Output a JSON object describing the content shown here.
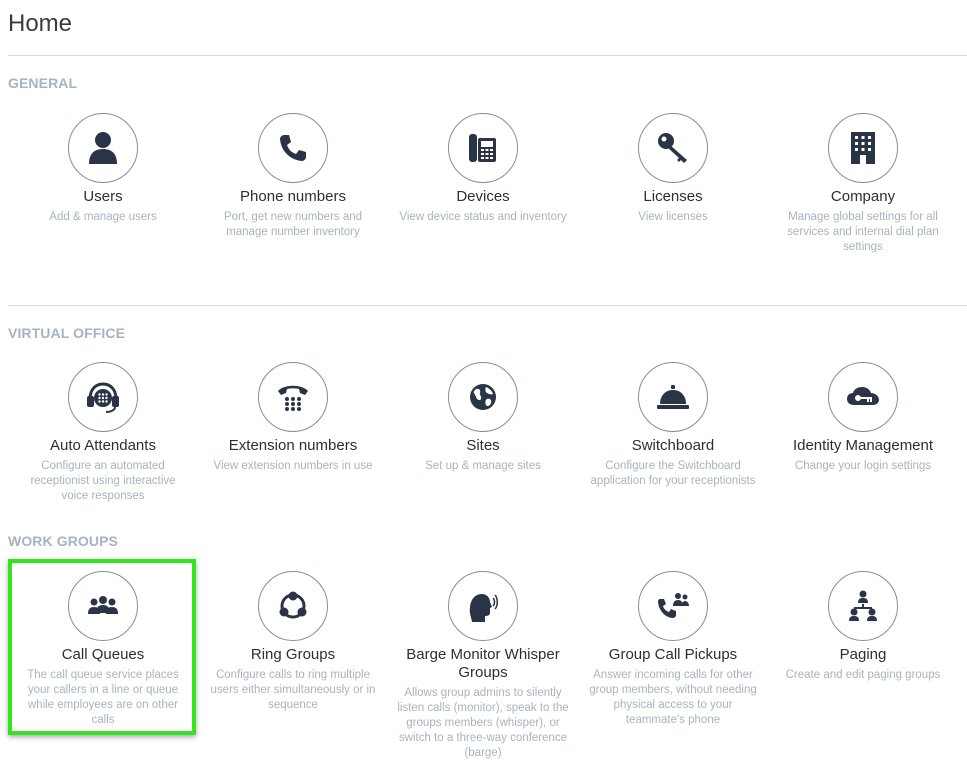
{
  "header": {
    "title": "Home"
  },
  "sections": {
    "general": {
      "title": "GENERAL",
      "tiles": [
        {
          "label": "Users",
          "desc": "Add & manage users",
          "icon": "user-icon"
        },
        {
          "label": "Phone numbers",
          "desc": "Port, get new numbers and manage number inventory",
          "icon": "phone-icon"
        },
        {
          "label": "Devices",
          "desc": "View device status and inventory",
          "icon": "desk-phone-icon"
        },
        {
          "label": "Licenses",
          "desc": "View licenses",
          "icon": "key-icon"
        },
        {
          "label": "Company",
          "desc": "Manage global settings for all services and internal dial plan settings",
          "icon": "building-icon"
        }
      ]
    },
    "virtual_office": {
      "title": "VIRTUAL OFFICE",
      "tiles": [
        {
          "label": "Auto Attendants",
          "desc": "Configure an automated receptionist using interactive voice responses",
          "icon": "headset-icon"
        },
        {
          "label": "Extension numbers",
          "desc": "View extension numbers in use",
          "icon": "dialpad-phone-icon"
        },
        {
          "label": "Sites",
          "desc": "Set up & manage sites",
          "icon": "globe-icon"
        },
        {
          "label": "Switchboard",
          "desc": "Configure the Switchboard application for your receptionists",
          "icon": "bell-icon"
        },
        {
          "label": "Identity Management",
          "desc": "Change your login settings",
          "icon": "cloud-key-icon"
        }
      ]
    },
    "work_groups": {
      "title": "WORK GROUPS",
      "tiles": [
        {
          "label": "Call Queues",
          "desc": "The call queue service places your callers in a line or queue while employees are on other calls",
          "icon": "people-group-icon"
        },
        {
          "label": "Ring Groups",
          "desc": "Configure calls to ring multiple users either simultaneously or in sequence",
          "icon": "ring-group-icon"
        },
        {
          "label": "Barge Monitor Whisper Groups",
          "desc": "Allows group admins to silently listen calls (monitor), speak to the groups members (whisper), or switch to a three-way conference (barge)",
          "icon": "speaking-head-icon"
        },
        {
          "label": "Group Call Pickups",
          "desc": "Answer incoming calls for other group members, without needing physical access to your teammate's phone",
          "icon": "phone-people-icon"
        },
        {
          "label": "Paging",
          "desc": "Create and edit paging groups",
          "icon": "hierarchy-icon"
        }
      ]
    }
  },
  "colors": {
    "icon": "#2b3447",
    "highlight": "#33e51f",
    "muted": "#a9b3bf"
  }
}
